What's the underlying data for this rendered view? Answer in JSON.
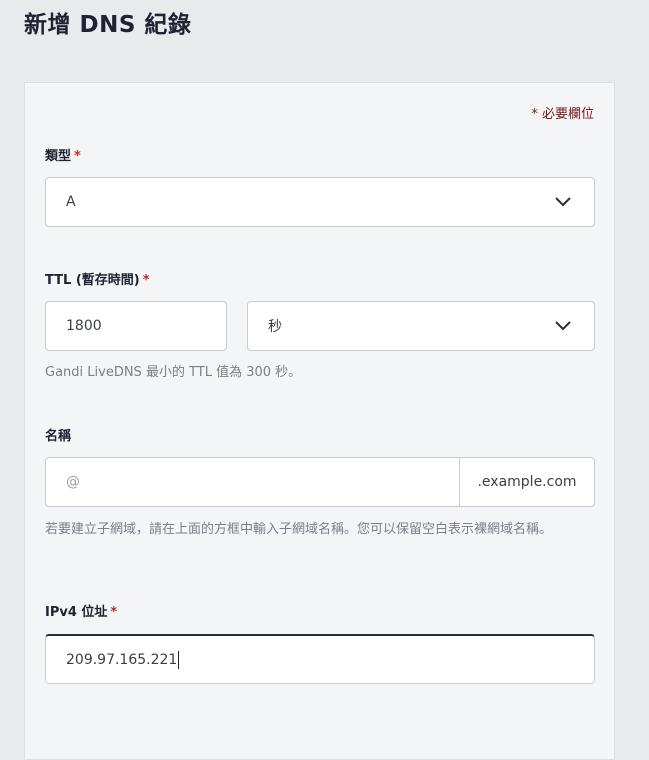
{
  "page": {
    "title": "新增 DNS 紀錄"
  },
  "form": {
    "required_note": "* 必要欄位",
    "type": {
      "label": "類型",
      "required_mark": "*",
      "value": "A"
    },
    "ttl": {
      "label": "TTL (暫存時間)",
      "required_mark": "*",
      "value": "1800",
      "unit": "秒",
      "help": "Gandi LiveDNS 最小的 TTL 值為 300 秒。"
    },
    "name": {
      "label": "名稱",
      "placeholder": "@",
      "suffix": ".example.com",
      "help": "若要建立子網域，請在上面的方框中輸入子網域名稱。您可以保留空白表示裸網域名稱。"
    },
    "ipv4": {
      "label": "IPv4 位址",
      "required_mark": "*",
      "value": "209.97.165.221"
    }
  },
  "icons": {
    "chevron": "chevron-down-icon"
  },
  "colors": {
    "background": "#e8eaee",
    "card": "#f4f5f7",
    "required": "#c62828",
    "note": "#7a1414"
  }
}
